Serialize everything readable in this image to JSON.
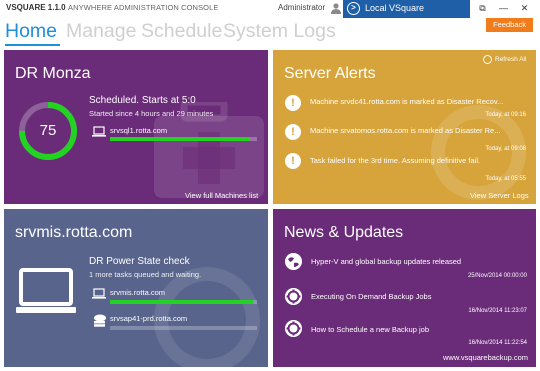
{
  "app": {
    "version_title": "VSQUARE 1.1.0",
    "subtitle": "ANYWHERE ADMINISTRATION CONSOLE",
    "user": "Administrator",
    "server": "Local VSquare",
    "feedback": "Feedback"
  },
  "nav": {
    "home": "Home",
    "manage": "Manage",
    "schedule": "Schedule",
    "system_logs": "System Logs",
    "active": "home"
  },
  "dr_monza": {
    "title": "DR Monza",
    "gauge_value": "75",
    "gauge_fraction": 0.75,
    "status": "Scheduled. Starts at 5:0",
    "since": "Started since 4 hours and 29 minutes",
    "machine": "srvsql1.rotta.com",
    "machine_progress": 0.95,
    "link": "View full Machines list"
  },
  "server_alerts": {
    "title": "Server Alerts",
    "refresh": "Refresh All",
    "alerts": [
      {
        "text": "Machine srvdc41.rotta.com is marked as Disaster Recov...",
        "time": "Today, at 09:16"
      },
      {
        "text": "Machine srvatomos.rotta.com is marked as Disaster Re...",
        "time": "Today, at 09:08"
      },
      {
        "text": "Task failed for the 3rd time. Assuming definitive fail.",
        "time": "Today, at 05:55"
      }
    ],
    "link": "View Server Logs"
  },
  "server_tile": {
    "title": "srvmis.rotta.com",
    "task": "DR Power State check",
    "queued": "1 more tasks queued and waiting.",
    "machines": [
      {
        "name": "srvmis.rotta.com",
        "progress": 0.97
      },
      {
        "name": "srvsap41-prd.rotta.com",
        "progress": 0.0
      }
    ]
  },
  "news": {
    "title": "News & Updates",
    "items": [
      {
        "text": "Hyper-V and global backup updates released",
        "time": "25/Nov/2014 00:00:00",
        "icon": "globe-icon"
      },
      {
        "text": "Executing On Demand Backup Jobs",
        "time": "16/Nov/2014 11:23:07",
        "icon": "lifebuoy-icon"
      },
      {
        "text": "How to Schedule a new Backup job",
        "time": "16/Nov/2014 11:22:54",
        "icon": "lifebuoy-icon"
      }
    ],
    "link": "www.vsquarebackup.com"
  },
  "colors": {
    "accent": "#1f8fd6",
    "purple_tile": "#6a2b78",
    "gold_tile": "#d6a43a",
    "slate_tile": "#58648c",
    "progress": "#22d322",
    "feedback": "#f07c1b",
    "server_select": "#1e5fa8"
  }
}
